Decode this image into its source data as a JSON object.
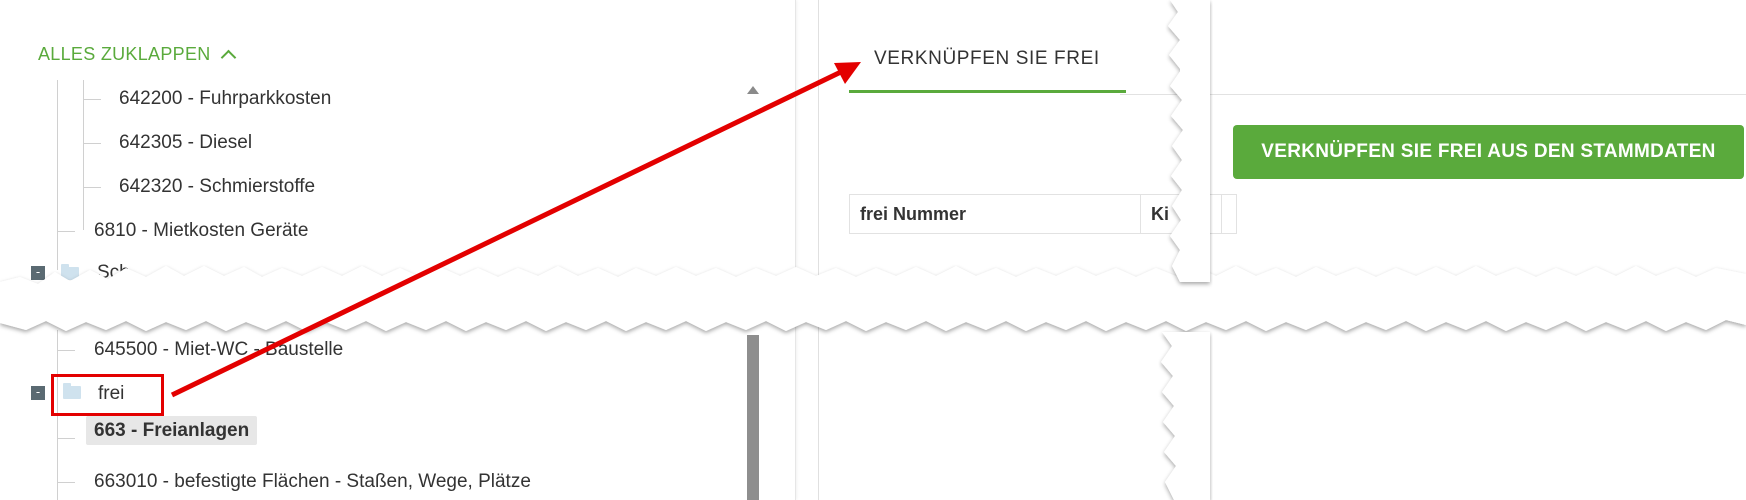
{
  "tree": {
    "collapse_all_label": "ALLES ZUKLAPPEN",
    "items_top": [
      "642200 - Fuhrparkkosten",
      "642305 - Diesel",
      "642320 - Schmierstoffe",
      "6810 - Mietkosten Geräte"
    ],
    "partial_folder_label": "Sch",
    "items_bottom": {
      "prev_item": "645500 - Miet-WC - Baustelle",
      "folder_label": "frei",
      "selected_item": "663 - Freianlagen",
      "next_item": "663010 - befestigte Flächen - Staßen, Wege, Plätze"
    },
    "toggle_symbol": "-"
  },
  "right": {
    "tab_label": "VERKNÜPFEN SIE FREI",
    "link_button_label": "VERKNÜPFEN SIE FREI AUS DEN STAMMDATEN",
    "table_headers": [
      "frei Nummer",
      "Ki"
    ]
  },
  "colors": {
    "accent_green": "#5aaa3c",
    "annotation_red": "#e30000"
  }
}
